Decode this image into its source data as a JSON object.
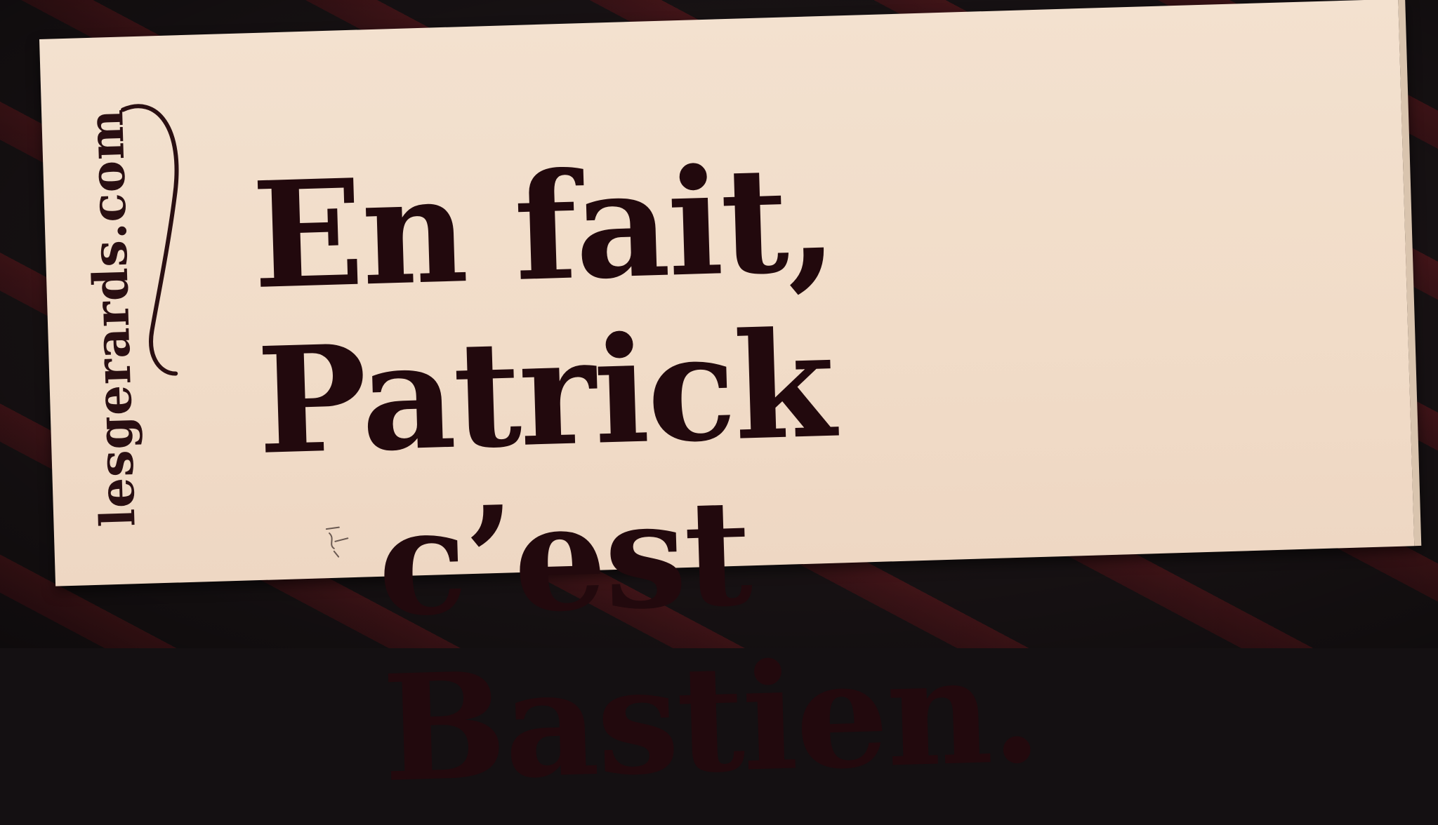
{
  "sticker": {
    "brand": "lesgerards.com",
    "headline_line1": "En fait, Patrick",
    "headline_line2": "c’est Bastien."
  },
  "colors": {
    "paper": "#f1dcc8",
    "ink": "#22090d",
    "stripe_red": "#4a171b",
    "stripe_dark": "#1a1416"
  },
  "icons": {
    "swoosh": "swoosh-icon",
    "pen_mark": "pen-mark-icon"
  }
}
